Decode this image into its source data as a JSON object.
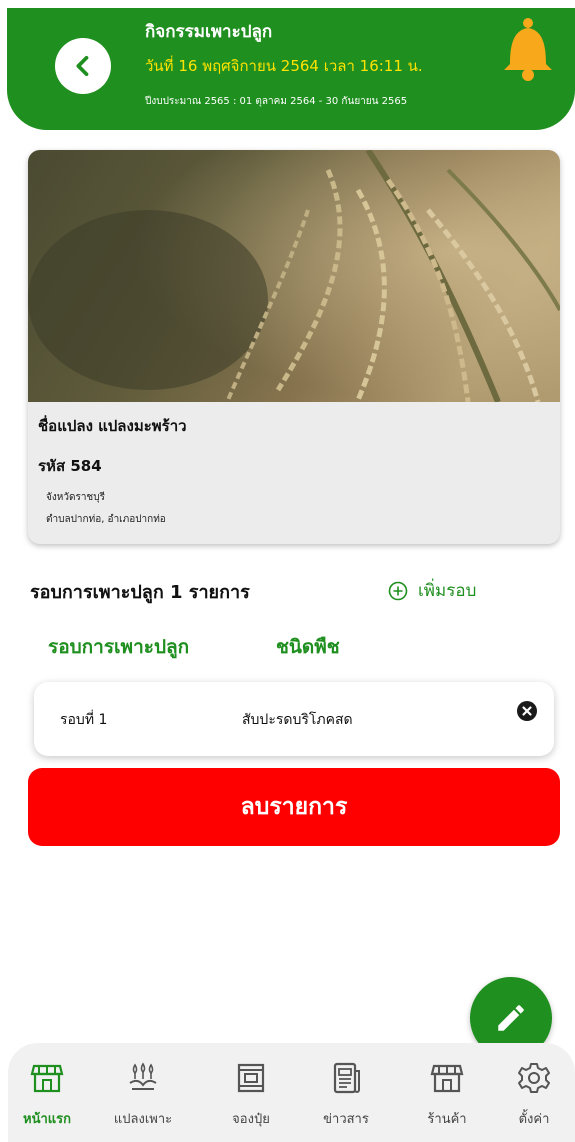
{
  "header": {
    "title": "กิจกรรมเพาะปลูก",
    "date": "วันที่ 16 พฤศจิกายน 2564 เวลา 16:11 น.",
    "budget_year": "ปีงบประมาณ 2565 : 01 ตุลาคม 2564 - 30 กันยายน 2565"
  },
  "plot": {
    "name": "ชื่อแปลง แปลงมะพร้าว",
    "code": "รหัส 584",
    "province": "จังหวัดราชบุรี",
    "address": "ตำบลปากท่อ, อำเภอปากท่อ"
  },
  "rounds": {
    "title": "รอบการเพาะปลูก 1 รายการ",
    "add_label": "เพิ่มรอบ",
    "col_round": "รอบการเพาะปลูก",
    "col_crop": "ชนิดพืช",
    "items": [
      {
        "round": "รอบที่ 1",
        "crop": "สับปะรดบริโภคสด"
      }
    ]
  },
  "delete_label": "ลบรายการ",
  "nav": [
    {
      "label": "หน้าแรก",
      "icon": "store-icon"
    },
    {
      "label": "แปลงเพาะ",
      "icon": "plant-icon"
    },
    {
      "label": "จองปุ๋ย",
      "icon": "fertilizer-icon"
    },
    {
      "label": "ข่าวสาร",
      "icon": "news-icon"
    },
    {
      "label": "ร้านค้า",
      "icon": "shop-icon"
    },
    {
      "label": "ตั้งค่า",
      "icon": "gear-icon"
    }
  ],
  "colors": {
    "primary_green": "#1f8f1f",
    "accent_yellow": "#ffe200",
    "danger_red": "#ff0000",
    "bell_orange": "#f7a81b"
  }
}
